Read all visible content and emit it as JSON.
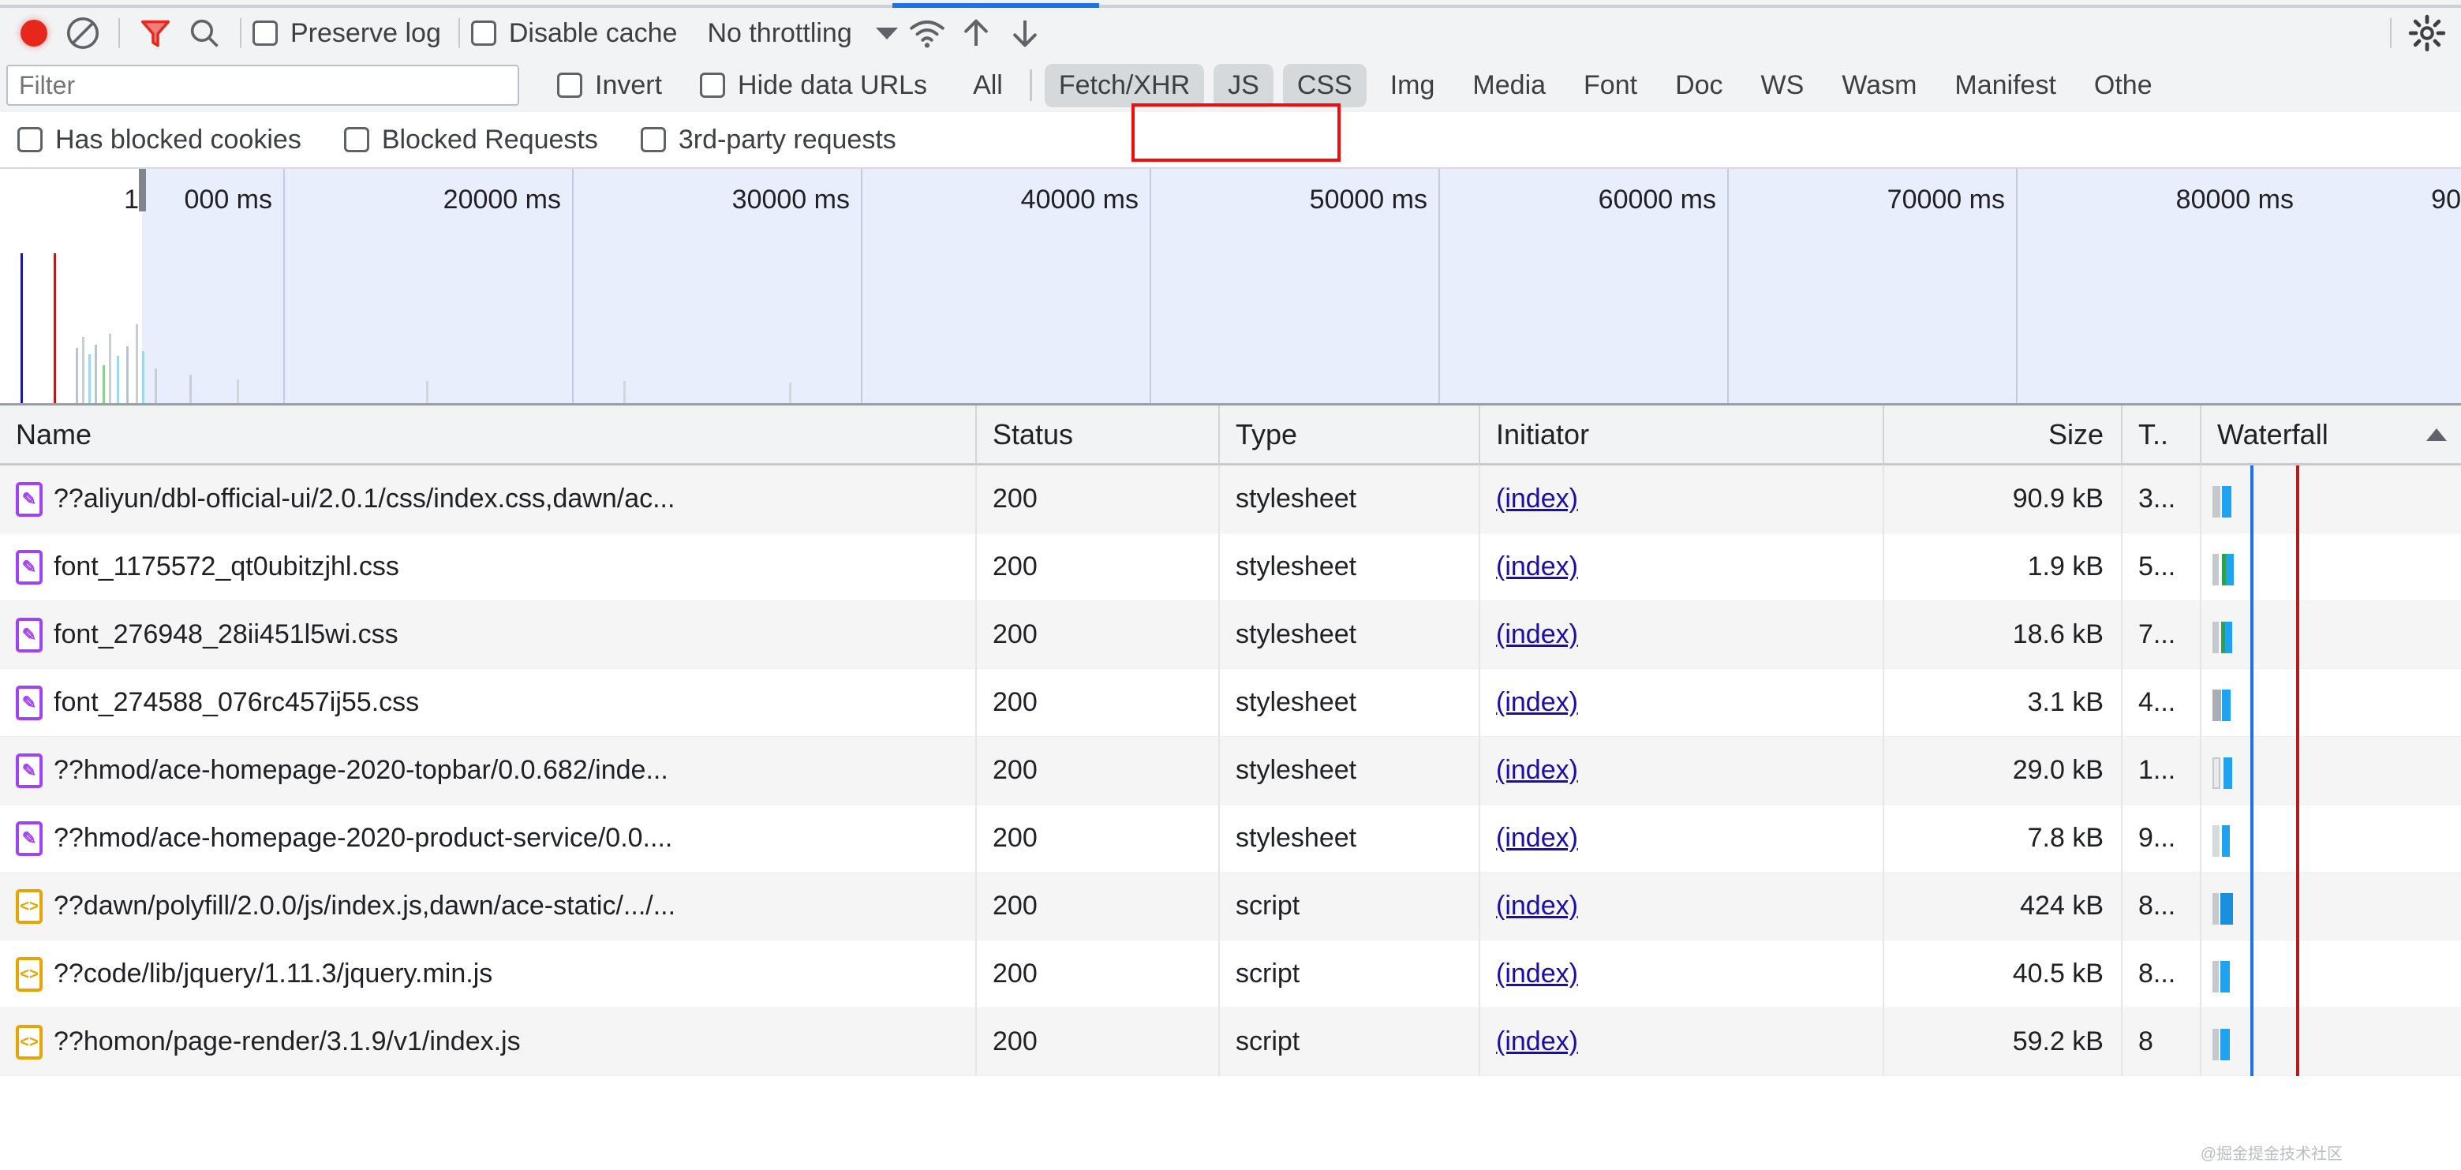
{
  "toolbar": {
    "record_icon": "record-circle-icon",
    "clear_icon": "clear-no-entry-icon",
    "filter_icon": "funnel-filter-icon",
    "search_icon": "magnifier-search-icon",
    "preserve_log_label": "Preserve log",
    "disable_cache_label": "Disable cache",
    "throttling_label": "No throttling",
    "caret_icon": "chevron-down-icon",
    "wifi_icon": "wifi-conditions-icon",
    "import_icon": "upload-har-icon",
    "export_icon": "download-har-icon",
    "settings_icon": "gear-settings-icon"
  },
  "filter_row": {
    "filter_placeholder": "Filter",
    "invert_label": "Invert",
    "hide_data_urls_label": "Hide data URLs",
    "types": [
      {
        "label": "All",
        "selected": false
      },
      {
        "label": "Fetch/XHR",
        "selected": true
      },
      {
        "label": "JS",
        "selected": true
      },
      {
        "label": "CSS",
        "selected": true
      },
      {
        "label": "Img",
        "selected": false
      },
      {
        "label": "Media",
        "selected": false
      },
      {
        "label": "Font",
        "selected": false
      },
      {
        "label": "Doc",
        "selected": false
      },
      {
        "label": "WS",
        "selected": false
      },
      {
        "label": "Wasm",
        "selected": false
      },
      {
        "label": "Manifest",
        "selected": false
      },
      {
        "label": "Othe",
        "selected": false
      }
    ],
    "highlight_color": "#f20d0d"
  },
  "options_row": {
    "has_blocked_cookies_label": "Has blocked cookies",
    "blocked_requests_label": "Blocked Requests",
    "third_party_requests_label": "3rd-party requests"
  },
  "overview": {
    "ticks": [
      "1",
      "000 ms",
      "20000 ms",
      "30000 ms",
      "40000 ms",
      "50000 ms",
      "60000 ms",
      "70000 ms",
      "80000 ms",
      "90"
    ],
    "tick_labels": [
      "000 ms",
      "20000 ms",
      "30000 ms",
      "40000 ms",
      "50000 ms",
      "60000 ms",
      "70000 ms",
      "80000 ms",
      "90"
    ],
    "leading_label": "1"
  },
  "table": {
    "columns": [
      "Name",
      "Status",
      "Type",
      "Initiator",
      "Size",
      "T..",
      "Waterfall"
    ],
    "rows": [
      {
        "icon": "stylesheet-icon",
        "name": "??aliyun/dbl-official-ui/2.0.1/css/index.css,dawn/ac...",
        "status": "200",
        "type": "stylesheet",
        "initiator": "(index)",
        "size": "90.9 kB",
        "time": "3..."
      },
      {
        "icon": "stylesheet-icon",
        "name": "font_1175572_qt0ubitzjhl.css",
        "status": "200",
        "type": "stylesheet",
        "initiator": "(index)",
        "size": "1.9 kB",
        "time": "5..."
      },
      {
        "icon": "stylesheet-icon",
        "name": "font_276948_28ii451l5wi.css",
        "status": "200",
        "type": "stylesheet",
        "initiator": "(index)",
        "size": "18.6 kB",
        "time": "7..."
      },
      {
        "icon": "stylesheet-icon",
        "name": "font_274588_076rc457ij55.css",
        "status": "200",
        "type": "stylesheet",
        "initiator": "(index)",
        "size": "3.1 kB",
        "time": "4..."
      },
      {
        "icon": "stylesheet-icon",
        "name": "??hmod/ace-homepage-2020-topbar/0.0.682/inde...",
        "status": "200",
        "type": "stylesheet",
        "initiator": "(index)",
        "size": "29.0 kB",
        "time": "1..."
      },
      {
        "icon": "stylesheet-icon",
        "name": "??hmod/ace-homepage-2020-product-service/0.0....",
        "status": "200",
        "type": "stylesheet",
        "initiator": "(index)",
        "size": "7.8 kB",
        "time": "9..."
      },
      {
        "icon": "script-icon",
        "name": "??dawn/polyfill/2.0.0/js/index.js,dawn/ace-static/.../...",
        "status": "200",
        "type": "script",
        "initiator": "(index)",
        "size": "424 kB",
        "time": "8..."
      },
      {
        "icon": "script-icon",
        "name": "??code/lib/jquery/1.11.3/jquery.min.js",
        "status": "200",
        "type": "script",
        "initiator": "(index)",
        "size": "40.5 kB",
        "time": "8..."
      },
      {
        "icon": "script-icon",
        "name": "??homon/page-render/3.1.9/v1/index.js",
        "status": "200",
        "type": "script",
        "initiator": "(index)",
        "size": "59.2 kB",
        "time": "8"
      }
    ]
  },
  "watermark": "@掘金提金技术社区"
}
